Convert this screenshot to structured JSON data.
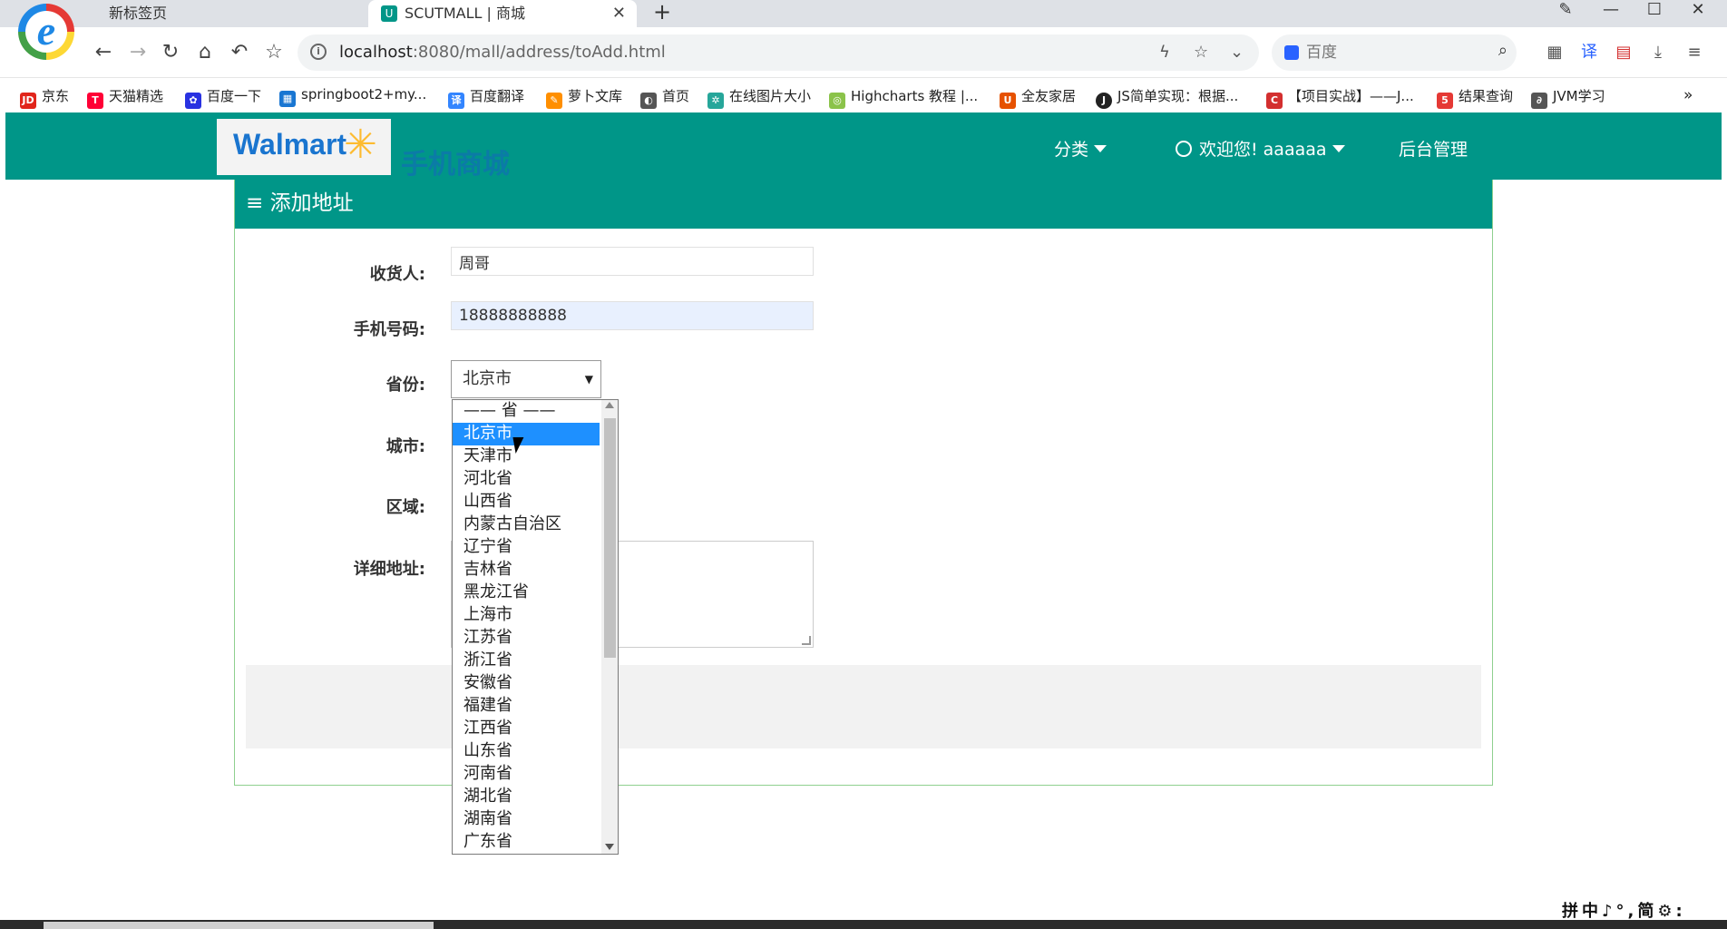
{
  "browser": {
    "tabs": [
      {
        "label": "新标签页"
      },
      {
        "label": "SCUTMALL | 商城"
      }
    ],
    "url_host": "localhost",
    "url_rest": ":8080/mall/address/toAdd.html",
    "search_placeholder": "百度",
    "bookmarks": [
      {
        "label": "京东",
        "color": "#e1251b",
        "icon": "JD"
      },
      {
        "label": "天猫精选",
        "color": "#ff0036",
        "icon": "T"
      },
      {
        "label": "百度一下",
        "color": "#2932e1",
        "icon": "✿"
      },
      {
        "label": "springboot2+my...",
        "color": "#1976d2",
        "icon": "▦"
      },
      {
        "label": "百度翻译",
        "color": "#3385ff",
        "icon": "译"
      },
      {
        "label": "萝卜文库",
        "color": "#ff8f00",
        "icon": "✎"
      },
      {
        "label": "首页",
        "color": "#555555",
        "icon": "◐"
      },
      {
        "label": "在线图片大小",
        "color": "#26a69a",
        "icon": "✲"
      },
      {
        "label": "Highcharts 教程 |...",
        "color": "#8bc34a",
        "icon": "◎"
      },
      {
        "label": "全友家居",
        "color": "#e65100",
        "icon": "U"
      },
      {
        "label": "JS简单实现：根据...",
        "color": "#222222",
        "icon": "J"
      },
      {
        "label": "【项目实战】——J...",
        "color": "#d32f2f",
        "icon": "C"
      },
      {
        "label": "结果查询",
        "color": "#e53935",
        "icon": "5"
      },
      {
        "label": "JVM学习",
        "color": "#555555",
        "icon": "∂"
      }
    ],
    "bookmarks_more": "»"
  },
  "header": {
    "logo": "Walmart",
    "logo_sub": "手机商城",
    "nav": {
      "category": "分类",
      "user": "欢迎您! aaaaaa",
      "admin": "后台管理"
    }
  },
  "form": {
    "title": "≡ 添加地址",
    "receiver_label": "收货人:",
    "receiver_value": "周哥",
    "phone_label": "手机号码:",
    "phone_value": "18888888888",
    "province_label": "省份:",
    "province_value": "北京市",
    "city_label": "城市:",
    "area_label": "区域:",
    "detail_label": "详细地址:"
  },
  "province_options": [
    "—— 省 ——",
    "北京市",
    "天津市",
    "河北省",
    "山西省",
    "内蒙古自治区",
    "辽宁省",
    "吉林省",
    "黑龙江省",
    "上海市",
    "江苏省",
    "浙江省",
    "安徽省",
    "福建省",
    "江西省",
    "山东省",
    "河南省",
    "湖北省",
    "湖南省",
    "广东省"
  ],
  "selected_index": 1,
  "ime_bar": "拼中♪°,简⚙:"
}
